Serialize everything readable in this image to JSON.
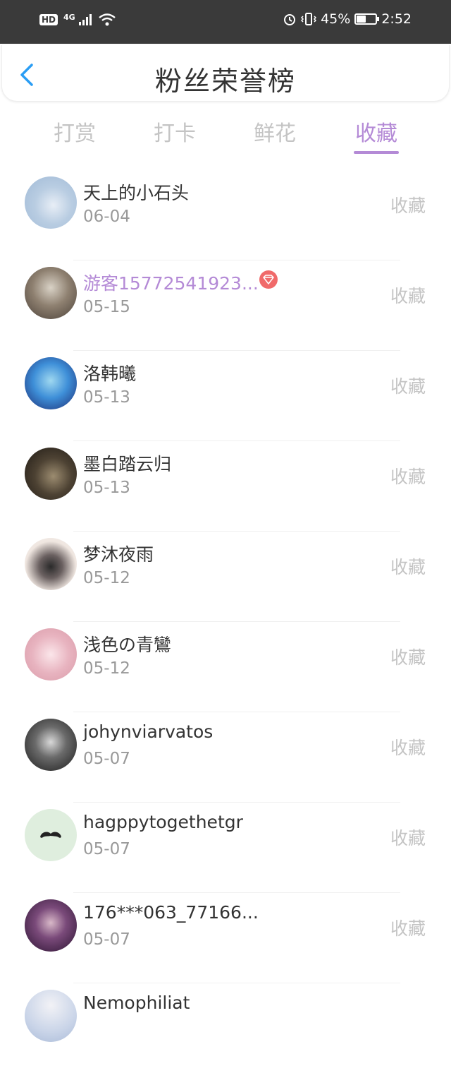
{
  "status_bar": {
    "hd": "HD",
    "network": "4G",
    "battery_percent": "45%",
    "time": "2:52"
  },
  "header": {
    "title": "粉丝荣誉榜"
  },
  "tabs": [
    {
      "label": "打赏",
      "active": false
    },
    {
      "label": "打卡",
      "active": false
    },
    {
      "label": "鲜花",
      "active": false
    },
    {
      "label": "收藏",
      "active": true
    }
  ],
  "list": [
    {
      "name": "天上的小石头",
      "date": "06-04",
      "action": "收藏",
      "vip": false
    },
    {
      "name": "游客15772541923...",
      "date": "05-15",
      "action": "收藏",
      "vip": true
    },
    {
      "name": "洛韩曦",
      "date": "05-13",
      "action": "收藏",
      "vip": false
    },
    {
      "name": "墨白踏云归",
      "date": "05-13",
      "action": "收藏",
      "vip": false
    },
    {
      "name": "梦沐夜雨",
      "date": "05-12",
      "action": "收藏",
      "vip": false
    },
    {
      "name": "浅色の青鸞",
      "date": "05-12",
      "action": "收藏",
      "vip": false
    },
    {
      "name": "johynviarvatos",
      "date": "05-07",
      "action": "收藏",
      "vip": false
    },
    {
      "name": "hagppytogethetgr",
      "date": "05-07",
      "action": "收藏",
      "vip": false
    },
    {
      "name": "176***063_77166...",
      "date": "05-07",
      "action": "收藏",
      "vip": false
    },
    {
      "name": "Nemophiliat",
      "date": "",
      "action": "",
      "vip": false
    }
  ],
  "colors": {
    "accent": "#b48ad6",
    "status_bar": "#3a3a3a",
    "back_arrow": "#2a9df4",
    "vip_badge": "#f06a6a"
  }
}
